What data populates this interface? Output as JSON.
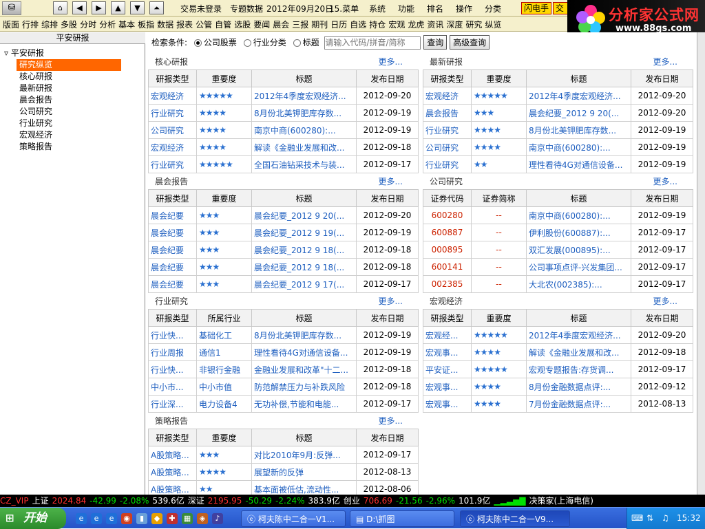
{
  "topbar": {
    "nav_glyphs": [
      "⌂",
      "◀",
      "▶",
      "▲",
      "▼",
      "⏶"
    ],
    "login_status": "交易未登录",
    "special": "专题数据",
    "date": "2012年09月20日",
    "menu_label": "15.菜单",
    "menus": [
      "系统",
      "功能",
      "排名",
      "操作",
      "分类"
    ],
    "flash_btn": "闪电手",
    "trade_btn": "交易"
  },
  "banner": {
    "title": "分析家公式网",
    "url": "www.88gs.com"
  },
  "toolbar": [
    "版面",
    "行排",
    "综排",
    "多股",
    "分时",
    "分析",
    "基本",
    "板指",
    "数据",
    "报表",
    "公管",
    "自管",
    "选股",
    "要闻",
    "晨会",
    "三报",
    "期刊",
    "日历",
    "自选",
    "持仓",
    "宏观",
    "龙虎",
    "资讯",
    "深度",
    "研究",
    "纵览"
  ],
  "left": {
    "header": "平安研报",
    "root": "平安研报",
    "items": [
      "研究纵览",
      "核心研报",
      "最新研报",
      "晨会报告",
      "公司研究",
      "行业研究",
      "宏观经济",
      "策略报告"
    ]
  },
  "search": {
    "label": "检索条件:",
    "opt1": "公司股票",
    "opt2": "行业分类",
    "opt3": "标题",
    "placeholder": "请输入代码/拼音/简称",
    "query": "查询",
    "advanced": "高级查询"
  },
  "more": "更多...",
  "panels": {
    "core": {
      "title": "核心研报",
      "headers": [
        "研报类型",
        "重要度",
        "标题",
        "发布日期"
      ],
      "rows": [
        [
          "宏观经济",
          "★★★★★",
          "2012年4季度宏观经济...",
          "2012-09-20"
        ],
        [
          "行业研究",
          "★★★★",
          "8月份北美钾肥库存数...",
          "2012-09-19"
        ],
        [
          "公司研究",
          "★★★★",
          "南京中商(600280):...",
          "2012-09-19"
        ],
        [
          "宏观经济",
          "★★★★",
          "解读《金融业发展和改...",
          "2012-09-18"
        ],
        [
          "行业研究",
          "★★★★★",
          "全国石油钻采技术与装...",
          "2012-09-17"
        ]
      ]
    },
    "latest": {
      "title": "最新研报",
      "headers": [
        "研报类型",
        "重要度",
        "标题",
        "发布日期"
      ],
      "rows": [
        [
          "宏观经济",
          "★★★★★",
          "2012年4季度宏观经济...",
          "2012-09-20"
        ],
        [
          "晨会报告",
          "★★★",
          "晨会纪要_2012 9 20(...",
          "2012-09-20"
        ],
        [
          "行业研究",
          "★★★★",
          "8月份北美钾肥库存数...",
          "2012-09-19"
        ],
        [
          "公司研究",
          "★★★★",
          "南京中商(600280):...",
          "2012-09-19"
        ],
        [
          "行业研究",
          "★★",
          "理性看待4G对通信设备...",
          "2012-09-19"
        ]
      ]
    },
    "morning": {
      "title": "晨会报告",
      "headers": [
        "研报类型",
        "重要度",
        "标题",
        "发布日期"
      ],
      "rows": [
        [
          "晨会纪要",
          "★★★",
          "晨会纪要_2012 9 20(...",
          "2012-09-20"
        ],
        [
          "晨会纪要",
          "★★★",
          "晨会纪要_2012 9 19(...",
          "2012-09-19"
        ],
        [
          "晨会纪要",
          "★★★",
          "晨会纪要_2012 9 18(...",
          "2012-09-18"
        ],
        [
          "晨会纪要",
          "★★★",
          "晨会纪要_2012 9 18(...",
          "2012-09-18"
        ],
        [
          "晨会纪要",
          "★★★",
          "晨会纪要_2012 9 17(...",
          "2012-09-17"
        ]
      ]
    },
    "company": {
      "title": "公司研究",
      "headers": [
        "证券代码",
        "证券简称",
        "标题",
        "发布日期"
      ],
      "rows": [
        [
          "600280",
          "--",
          "南京中商(600280):...",
          "2012-09-19"
        ],
        [
          "600887",
          "--",
          "伊利股份(600887):...",
          "2012-09-17"
        ],
        [
          "000895",
          "--",
          "双汇发展(000895):...",
          "2012-09-17"
        ],
        [
          "600141",
          "--",
          "公司事项点评-兴发集团...",
          "2012-09-17"
        ],
        [
          "002385",
          "--",
          "大北农(002385):...",
          "2012-09-17"
        ]
      ]
    },
    "industry": {
      "title": "行业研究",
      "headers": [
        "研报类型",
        "所属行业",
        "标题",
        "发布日期"
      ],
      "rows": [
        [
          "行业快...",
          "基础化工",
          "8月份北美钾肥库存数...",
          "2012-09-19"
        ],
        [
          "行业周报",
          "通信1",
          "理性看待4G对通信设备...",
          "2012-09-19"
        ],
        [
          "行业快...",
          "非银行金融",
          "金融业发展和改革\"十二...",
          "2012-09-18"
        ],
        [
          "中小市...",
          "中小市值",
          "防范解禁压力与补跌风险",
          "2012-09-18"
        ],
        [
          "行业深...",
          "电力设备4",
          "无功补偿,节能和电能...",
          "2012-09-17"
        ]
      ]
    },
    "macro": {
      "title": "宏观经济",
      "headers": [
        "研报类型",
        "重要度",
        "标题",
        "发布日期"
      ],
      "rows": [
        [
          "宏观经...",
          "★★★★★",
          "2012年4季度宏观经济...",
          "2012-09-20"
        ],
        [
          "宏观事...",
          "★★★★",
          "解读《金融业发展和改...",
          "2012-09-18"
        ],
        [
          "平安证...",
          "★★★★★",
          "宏观专题报告:存货调...",
          "2012-09-17"
        ],
        [
          "宏观事...",
          "★★★★",
          "8月份金融数据点评:...",
          "2012-09-12"
        ],
        [
          "宏观事...",
          "★★★★",
          "7月份金融数据点评:...",
          "2012-08-13"
        ]
      ]
    },
    "strategy": {
      "title": "策略报告",
      "headers": [
        "研报类型",
        "重要度",
        "标题",
        "发布日期"
      ],
      "rows": [
        [
          "A股策略...",
          "★★★",
          "对比2010年9月:反弹...",
          "2012-09-17"
        ],
        [
          "A股策略...",
          "★★★★",
          "展望新的反弹",
          "2012-08-13"
        ],
        [
          "A股策略...",
          "★★",
          "基本面被低估,流动性...",
          "2012-08-06"
        ]
      ]
    }
  },
  "status": {
    "vip": "CZ_VIP",
    "sh": "上证",
    "sh_idx": "2024.84",
    "sh_chg": "-42.99",
    "sh_pct": "-2.08%",
    "sh_vol": "539.6亿",
    "sz": "深证",
    "sz_idx": "2195.95",
    "sz_chg": "-50.29",
    "sz_pct": "-2.24%",
    "sz_vol": "383.9亿",
    "cy": "创业",
    "cy_idx": "706.69",
    "cy_chg": "-21.56",
    "cy_pct": "-2.96%",
    "cy_vol": "101.9亿",
    "server": "决策家(上海电信)"
  },
  "taskbar": {
    "start": "开始",
    "tasks": [
      "柯夫陈中二合一V1...",
      "D:\\抓图",
      "柯夫陈中二合一V9..."
    ],
    "clock": "15:32"
  }
}
